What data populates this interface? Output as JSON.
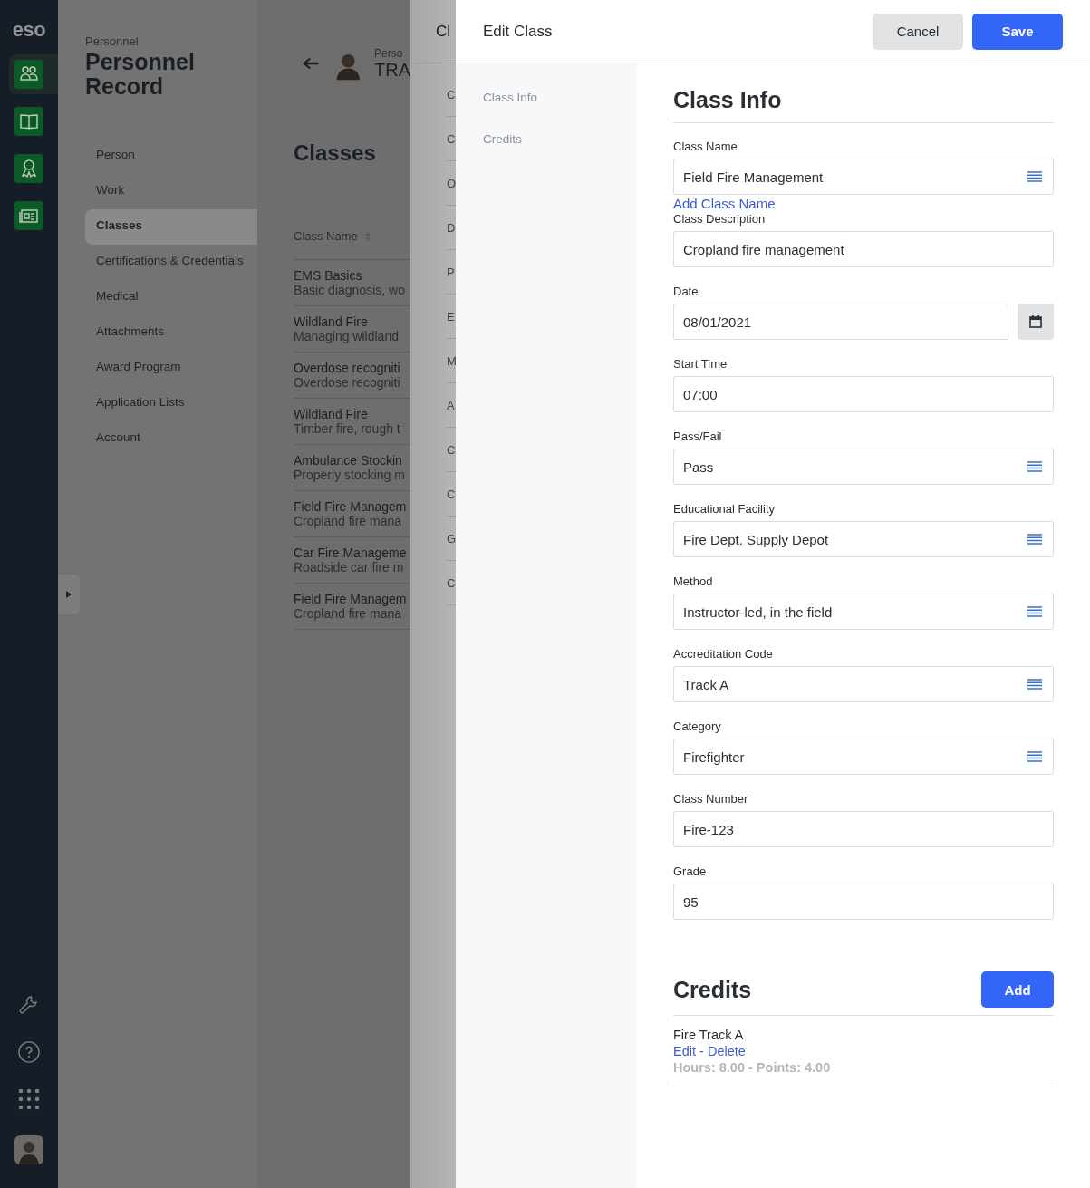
{
  "rail": {
    "logo": "eso",
    "nav": [
      {
        "kind": "people",
        "selected": true
      },
      {
        "kind": "book",
        "selected": false
      },
      {
        "kind": "ribbon",
        "selected": false
      },
      {
        "kind": "newspaper",
        "selected": false
      }
    ],
    "tools": [
      {
        "kind": "wrench"
      },
      {
        "kind": "help"
      },
      {
        "kind": "apps"
      },
      {
        "kind": "avatar"
      }
    ]
  },
  "sidebar": {
    "eyebrow": "Personnel",
    "title": "Personnel Record",
    "items": [
      {
        "label": "Person",
        "selected": false
      },
      {
        "label": "Work",
        "selected": false
      },
      {
        "label": "Classes",
        "selected": true
      },
      {
        "label": "Certifications & Credentials",
        "selected": false
      },
      {
        "label": "Medical",
        "selected": false
      },
      {
        "label": "Attachments",
        "selected": false
      },
      {
        "label": "Award Program",
        "selected": false
      },
      {
        "label": "Application Lists",
        "selected": false
      },
      {
        "label": "Account",
        "selected": false
      }
    ]
  },
  "person": {
    "eyebrow": "Perso",
    "name": "TRA"
  },
  "classes": {
    "title": "Classes",
    "column": "Class Name",
    "rows": [
      {
        "name": "EMS Basics",
        "description": "Basic diagnosis, wo"
      },
      {
        "name": "Wildland Fire",
        "description": "Managing wildland"
      },
      {
        "name": "Overdose recogniti",
        "description": "Overdose recogniti"
      },
      {
        "name": "Wildland Fire",
        "description": "Timber fire, rough t"
      },
      {
        "name": "Ambulance Stockin",
        "description": "Properly stocking m"
      },
      {
        "name": "Field Fire Managem",
        "description": "Cropland fire mana"
      },
      {
        "name": "Car Fire Manageme",
        "description": "Roadside car fire m"
      },
      {
        "name": "Field Fire Managem",
        "description": "Cropland fire mana"
      }
    ]
  },
  "class_panel": {
    "title": "Cl",
    "rows": [
      "C",
      "C",
      "O",
      "D",
      "P",
      "E",
      "M",
      "A",
      "C",
      "C",
      "G",
      "C"
    ]
  },
  "edit_class": {
    "title": "Edit Class",
    "buttons": {
      "cancel": "Cancel",
      "save": "Save"
    },
    "nav": [
      {
        "label": "Class Info",
        "selected": false
      },
      {
        "label": "Credits",
        "selected": false
      }
    ],
    "section_title": "Class Info",
    "fields": [
      {
        "label": "Class Name",
        "value": "Field Fire Management",
        "kind": "select",
        "link": "Add Class Name"
      },
      {
        "label": "Class Description",
        "value": "Cropland fire management",
        "kind": "text"
      },
      {
        "label": "Date",
        "value": "08/01/2021",
        "kind": "date"
      },
      {
        "label": "Start Time",
        "value": "07:00",
        "kind": "text"
      },
      {
        "label": "Pass/Fail",
        "value": "Pass",
        "kind": "select"
      },
      {
        "label": "Educational Facility",
        "value": "Fire Dept. Supply Depot",
        "kind": "select"
      },
      {
        "label": "Method",
        "value": "Instructor-led, in the field",
        "kind": "select"
      },
      {
        "label": "Accreditation Code",
        "value": "Track A",
        "kind": "select"
      },
      {
        "label": "Category",
        "value": "Firefighter",
        "kind": "select"
      },
      {
        "label": "Class Number",
        "value": "Fire-123",
        "kind": "text"
      },
      {
        "label": "Grade",
        "value": "95",
        "kind": "text"
      }
    ],
    "credits": {
      "title": "Credits",
      "add": "Add",
      "items": [
        {
          "name": "Fire Track A",
          "edit": "Edit",
          "separator": "-",
          "delete": "Delete",
          "details": "Hours: 8.00 - Points: 4.00"
        }
      ]
    }
  }
}
